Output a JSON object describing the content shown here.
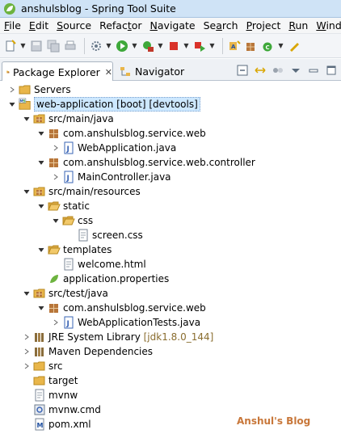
{
  "window": {
    "title": "anshulsblog - Spring Tool Suite"
  },
  "menu": {
    "items": [
      {
        "underline": "F",
        "rest": "ile"
      },
      {
        "underline": "E",
        "rest": "dit"
      },
      {
        "underline": "S",
        "rest": "ource"
      },
      {
        "prefix": "Refac",
        "underline": "t",
        "rest": "or"
      },
      {
        "underline": "N",
        "rest": "avigate"
      },
      {
        "prefix": "Se",
        "underline": "a",
        "rest": "rch"
      },
      {
        "underline": "P",
        "rest": "roject"
      },
      {
        "underline": "R",
        "rest": "un"
      },
      {
        "underline": "W",
        "rest": "indow"
      }
    ]
  },
  "toolbar": {
    "icons": [
      "new-icon",
      "save-icon",
      "save-all-icon",
      "print-icon",
      "gear-icon",
      "debug-icon",
      "run-icon",
      "run-external-icon",
      "stop-icon",
      "relaunch-icon",
      "new-java-project-icon",
      "new-package-icon",
      "new-class-icon",
      "pen-icon"
    ]
  },
  "views": {
    "active_tab": "Package Explorer",
    "active_close": "✕",
    "inactive_tab": "Navigator"
  },
  "tree": {
    "rows": [
      {
        "name": "Servers"
      },
      {
        "name": "web-application",
        "decoration": "[boot] [devtools]"
      },
      {
        "name": "src/main/java"
      },
      {
        "name": "com.anshulsblog.service.web"
      },
      {
        "name": "WebApplication.java"
      },
      {
        "name": "com.anshulsblog.service.web.controller"
      },
      {
        "name": "MainController.java"
      },
      {
        "name": "src/main/resources"
      },
      {
        "name": "static"
      },
      {
        "name": "css"
      },
      {
        "name": "screen.css"
      },
      {
        "name": "templates"
      },
      {
        "name": "welcome.html"
      },
      {
        "name": "application.properties"
      },
      {
        "name": "src/test/java"
      },
      {
        "name": "com.anshulsblog.service.web"
      },
      {
        "name": "WebApplicationTests.java"
      },
      {
        "name": "JRE System Library",
        "decoration": "[jdk1.8.0_144]"
      },
      {
        "name": "Maven Dependencies"
      },
      {
        "name": "src"
      },
      {
        "name": "target"
      },
      {
        "name": "mvnw"
      },
      {
        "name": "mvnw.cmd"
      },
      {
        "name": "pom.xml"
      }
    ]
  },
  "watermark": "Anshul's Blog",
  "colors": {
    "folder": "#e9b64a",
    "package": "#b8763a",
    "java": "#3a64b5",
    "selection": "#cde8ff"
  }
}
